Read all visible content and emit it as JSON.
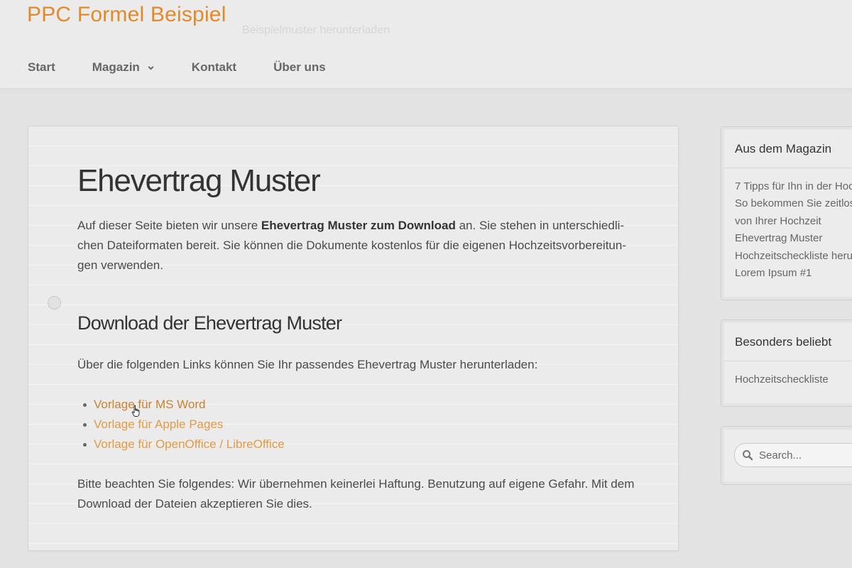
{
  "site": {
    "title": "PPC Formel Beispiel",
    "tagline": "Beispielmuster herunterladen"
  },
  "nav": {
    "items": [
      "Start",
      "Magazin",
      "Kontakt",
      "Über uns"
    ]
  },
  "article": {
    "title": "Ehevertrag Muster",
    "intro_before": "Auf dieser Seite bieten wir unsere ",
    "intro_bold": "Ehevertrag Muster zum Download",
    "intro_after": " an. Sie stehen in unterschiedli-chen Dateiformaten bereit. Sie können die Dokumente kostenlos für die eigenen Hochzeitsvorbereitun-gen verwenden.",
    "section_title": "Download der Ehevertrag Muster",
    "section_text": "Über die folgenden Links können Sie Ihr passendes Ehevertrag Muster herunterladen:",
    "downloads": [
      "Vorlage für MS Word",
      "Vorlage für Apple Pages",
      "Vorlage für OpenOffice / LibreOffice"
    ],
    "disclaimer": "Bitte beachten Sie folgendes: Wir übernehmen keinerlei Haftung. Benutzung auf eigene Gefahr. Mit dem Download der Dateien akzeptieren Sie dies."
  },
  "sidebar": {
    "magazine": {
      "title": "Aus dem Magazin",
      "items": [
        "7 Tipps für Ihn in der Hoc",
        "So bekommen Sie zeitlos",
        "von Ihrer Hochzeit",
        "Ehevertrag Muster",
        "Hochzeitscheckliste heru",
        "Lorem Ipsum #1"
      ]
    },
    "popular": {
      "title": "Besonders beliebt",
      "items": [
        "Hochzeitscheckliste"
      ]
    },
    "search": {
      "placeholder": "Search..."
    }
  },
  "colors": {
    "accent": "#e08a2a",
    "link": "#e39a43",
    "background": "#e3e3e3"
  }
}
